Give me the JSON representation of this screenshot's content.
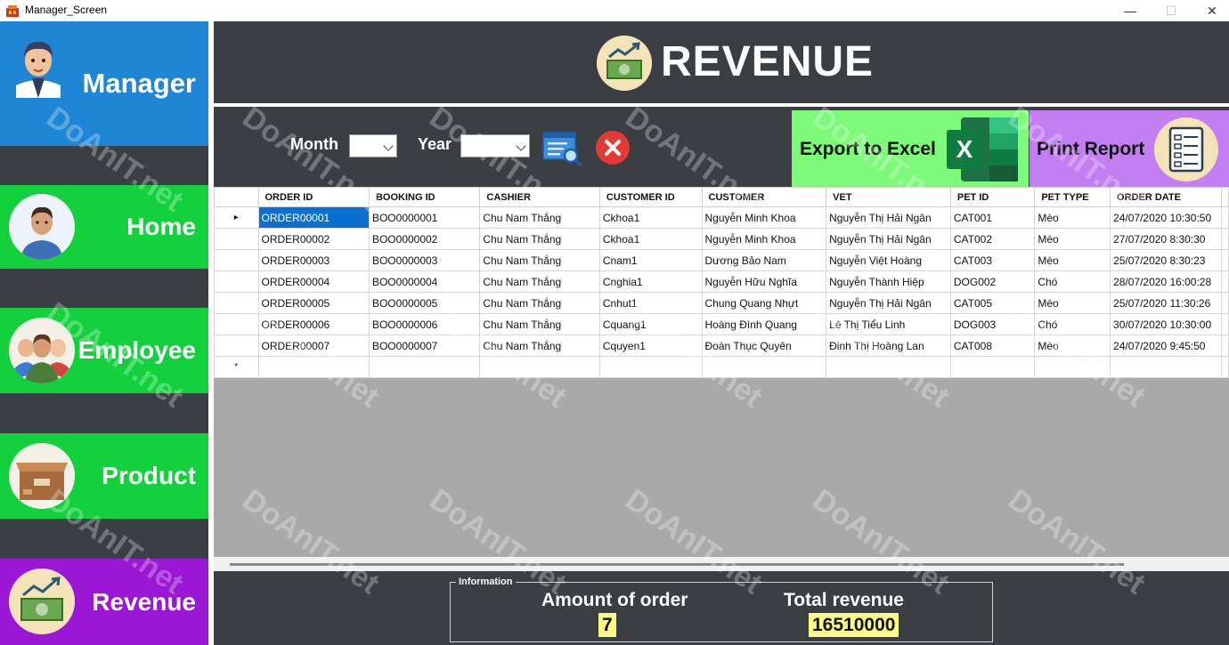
{
  "window": {
    "title": "Manager_Screen",
    "min": "—",
    "max": "☐",
    "close": "✕"
  },
  "sidebar": {
    "items": [
      {
        "label": "Manager"
      },
      {
        "label": "Home"
      },
      {
        "label": "Employee"
      },
      {
        "label": "Product"
      },
      {
        "label": "Revenue"
      }
    ]
  },
  "header": {
    "title": "REVENUE"
  },
  "filters": {
    "month_label": "Month",
    "year_label": "Year",
    "month_value": "",
    "year_value": ""
  },
  "actions": {
    "export_label": "Export to Excel",
    "print_label": "Print Report",
    "excel_letter": "X"
  },
  "grid": {
    "columns": [
      "ORDER ID",
      "BOOKING ID",
      "CASHIER",
      "CUSTOMER ID",
      "CUSTOMER",
      "VET",
      "PET ID",
      "PET TYPE",
      "ORDER DATE"
    ],
    "rows": [
      [
        "ORDER00001",
        "BOO0000001",
        "Chu Nam Thắng",
        "Ckhoa1",
        "Nguyễn Minh Khoa",
        "Nguyễn Thị Hải Ngân",
        "CAT001",
        "Mèo",
        "24/07/2020 10:30:50"
      ],
      [
        "ORDER00002",
        "BOO0000002",
        "Chu Nam Thắng",
        "Ckhoa1",
        "Nguyễn Minh Khoa",
        "Nguyễn Thị Hải Ngân",
        "CAT002",
        "Mèo",
        "27/07/2020 8:30:30"
      ],
      [
        "ORDER00003",
        "BOO0000003",
        "Chu Nam Thắng",
        "Cnam1",
        "Dương Bảo Nam",
        "Nguyễn Việt Hoàng",
        "CAT003",
        "Mèo",
        "25/07/2020 8:30:23"
      ],
      [
        "ORDER00004",
        "BOO0000004",
        "Chu Nam Thắng",
        "Cnghia1",
        "Nguyễn Hữu Nghĩa",
        "Nguyễn Thành Hiệp",
        "DOG002",
        "Chó",
        "28/07/2020 16:00:28"
      ],
      [
        "ORDER00005",
        "BOO0000005",
        "Chu Nam Thắng",
        "Cnhut1",
        "Chung Quang Nhựt",
        "Nguyễn Thị Hải Ngân",
        "CAT005",
        "Mèo",
        "25/07/2020 11:30:26"
      ],
      [
        "ORDER00006",
        "BOO0000006",
        "Chu Nam Thắng",
        "Cquang1",
        "Hoàng Đình Quang",
        "Lê Thị Tiểu Linh",
        "DOG003",
        "Chó",
        "30/07/2020 10:30:00"
      ],
      [
        "ORDER00007",
        "BOO0000007",
        "Chu Nam Thắng",
        "Cquyen1",
        "Đoàn Thục Quyên",
        "Đinh Thị Hoàng Lan",
        "CAT008",
        "Mèo",
        "24/07/2020 9:45:50"
      ]
    ],
    "current_marker": "▸",
    "new_row_marker": "*"
  },
  "info": {
    "legend": "Information",
    "amount_label": "Amount of order",
    "amount_value": "7",
    "total_label": "Total revenue",
    "total_value": "16510000"
  },
  "watermark": {
    "text": "DoAnIT.net"
  },
  "colors": {
    "dark_bg": "#3b3f44",
    "manager_blue": "#1f86d6",
    "nav_green": "#13d13c",
    "revenue_purple": "#9b17d6",
    "export_green": "#7dfa7a",
    "print_purple": "#c37ef2",
    "highlight_yellow": "#fdfb88",
    "selection_blue": "#0b6fd0",
    "excel_green": "#1e7145"
  },
  "icons": [
    "app-icon",
    "manager-avatar-icon",
    "home-avatar-icon",
    "employee-group-icon",
    "product-box-icon",
    "revenue-money-icon",
    "search-list-icon",
    "clear-x-icon",
    "excel-icon",
    "report-checklist-icon"
  ]
}
